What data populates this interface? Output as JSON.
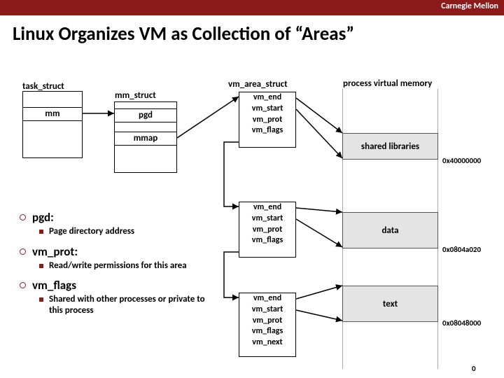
{
  "header": {
    "brand": "Carnegie Mellon"
  },
  "title": "Linux Organizes VM as Collection of “Areas”",
  "labels": {
    "task_struct": "task_struct",
    "mm_struct": "mm_struct",
    "mm": "mm",
    "pgd": "pgd",
    "mmap": "mmap",
    "vm_area_struct": "vm_area_struct",
    "pvm": "process virtual memory"
  },
  "vma": {
    "a": [
      "vm_end",
      "vm_start",
      "vm_prot",
      "vm_flags"
    ],
    "b": [
      "vm_end",
      "vm_start",
      "vm_prot",
      "vm_flags"
    ],
    "c": [
      "vm_end",
      "vm_start",
      "vm_prot",
      "vm_flags",
      "vm_next"
    ]
  },
  "pvm": {
    "regions": {
      "shared": "shared libraries",
      "data": "data",
      "text": "text"
    },
    "addrs": {
      "shared_top": "0x40000000",
      "data_bottom": "0x0804a020",
      "text_bottom": "0x08048000",
      "zero": "0"
    }
  },
  "bullets": {
    "pgd": {
      "h": "pgd:",
      "s": "Page directory address"
    },
    "prot": {
      "h": "vm_prot:",
      "s": "Read/write permissions for this area"
    },
    "flags": {
      "h": "vm_flags",
      "s": "Shared with other processes or private to this process"
    }
  }
}
